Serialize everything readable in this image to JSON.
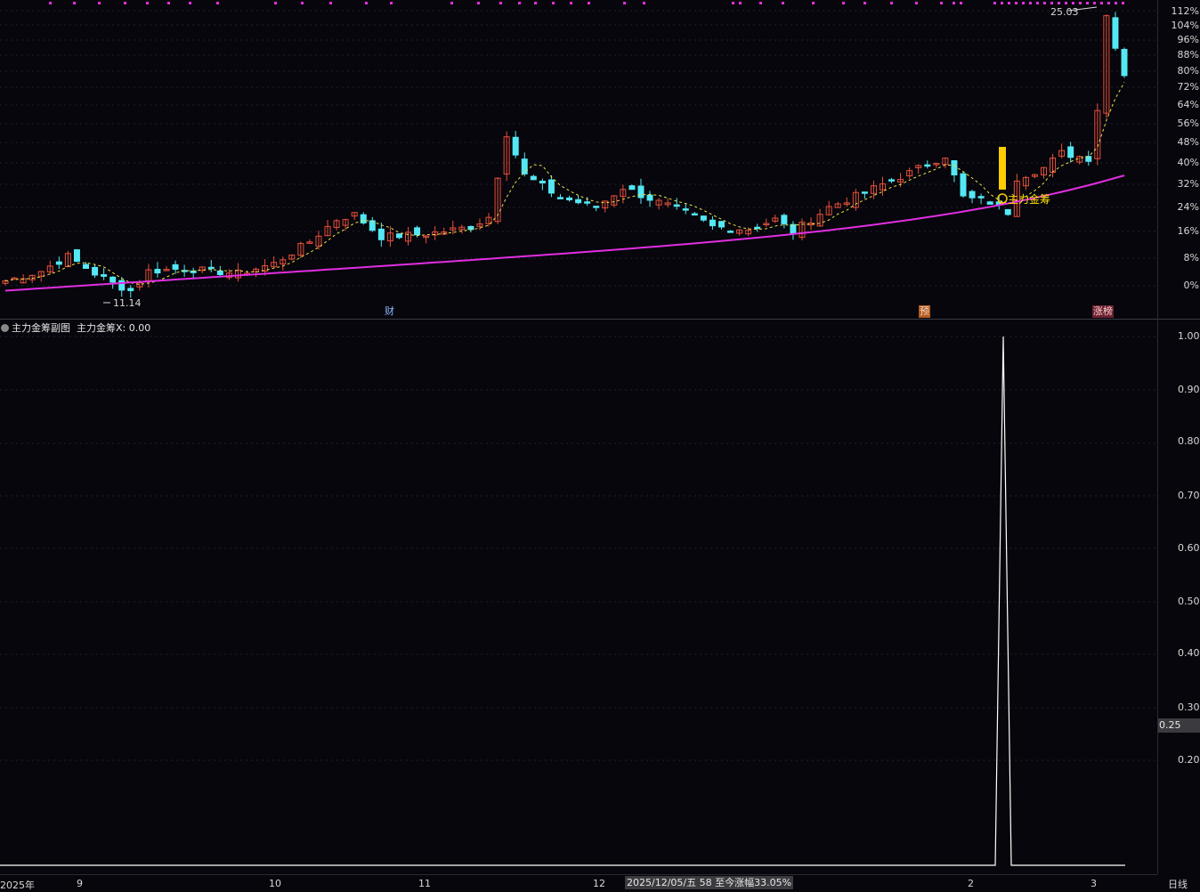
{
  "main_chart": {
    "percent_axis": [
      "112%",
      "104%",
      "96%",
      "88%",
      "80%",
      "72%",
      "64%",
      "56%",
      "48%",
      "40%",
      "32%",
      "24%",
      "16%",
      "8%",
      "0%"
    ],
    "high_label": "25.03",
    "low_label": "11.14",
    "signal_label": "主力金筹",
    "event_tags": {
      "cai": "财",
      "yu": "预",
      "zhangbang": "涨榜"
    },
    "colors": {
      "up": "#e8503c",
      "down": "#54e8f4",
      "ma_short": "#f2e04a",
      "ma_long": "#e22ee2",
      "signal": "#ffcc00",
      "top_dots": "#e22ee2"
    }
  },
  "indicator": {
    "name": "主力金筹副图",
    "series_label": "主力金筹X: 0.00",
    "axis": [
      "1.00",
      "0.90",
      "0.80",
      "0.70",
      "0.60",
      "0.50",
      "0.40",
      "0.30",
      "0.20"
    ],
    "current_value": "0.25",
    "line_color": "#ffffff"
  },
  "time_axis": {
    "labels": [
      "2025年",
      "9",
      "10",
      "11",
      "12",
      "2",
      "3"
    ],
    "cursor_text": "2025/12/05/五 58 至今涨幅33.05%",
    "period": "日线"
  },
  "chart_data": [
    {
      "type": "candlestick",
      "title": "",
      "y_axis": "percent change",
      "ylim": [
        -2,
        115
      ],
      "candles_count": 126,
      "low_marker": 11.14,
      "high_marker": 25.03,
      "grid": true
    },
    {
      "type": "line",
      "title": "主力金筹副图",
      "series": [
        {
          "name": "主力金筹X",
          "values_description": "0 everywhere except a single spike",
          "spike_value": 1.0,
          "spike_index": 112
        }
      ],
      "ylim": [
        0.1,
        1.02
      ]
    }
  ]
}
